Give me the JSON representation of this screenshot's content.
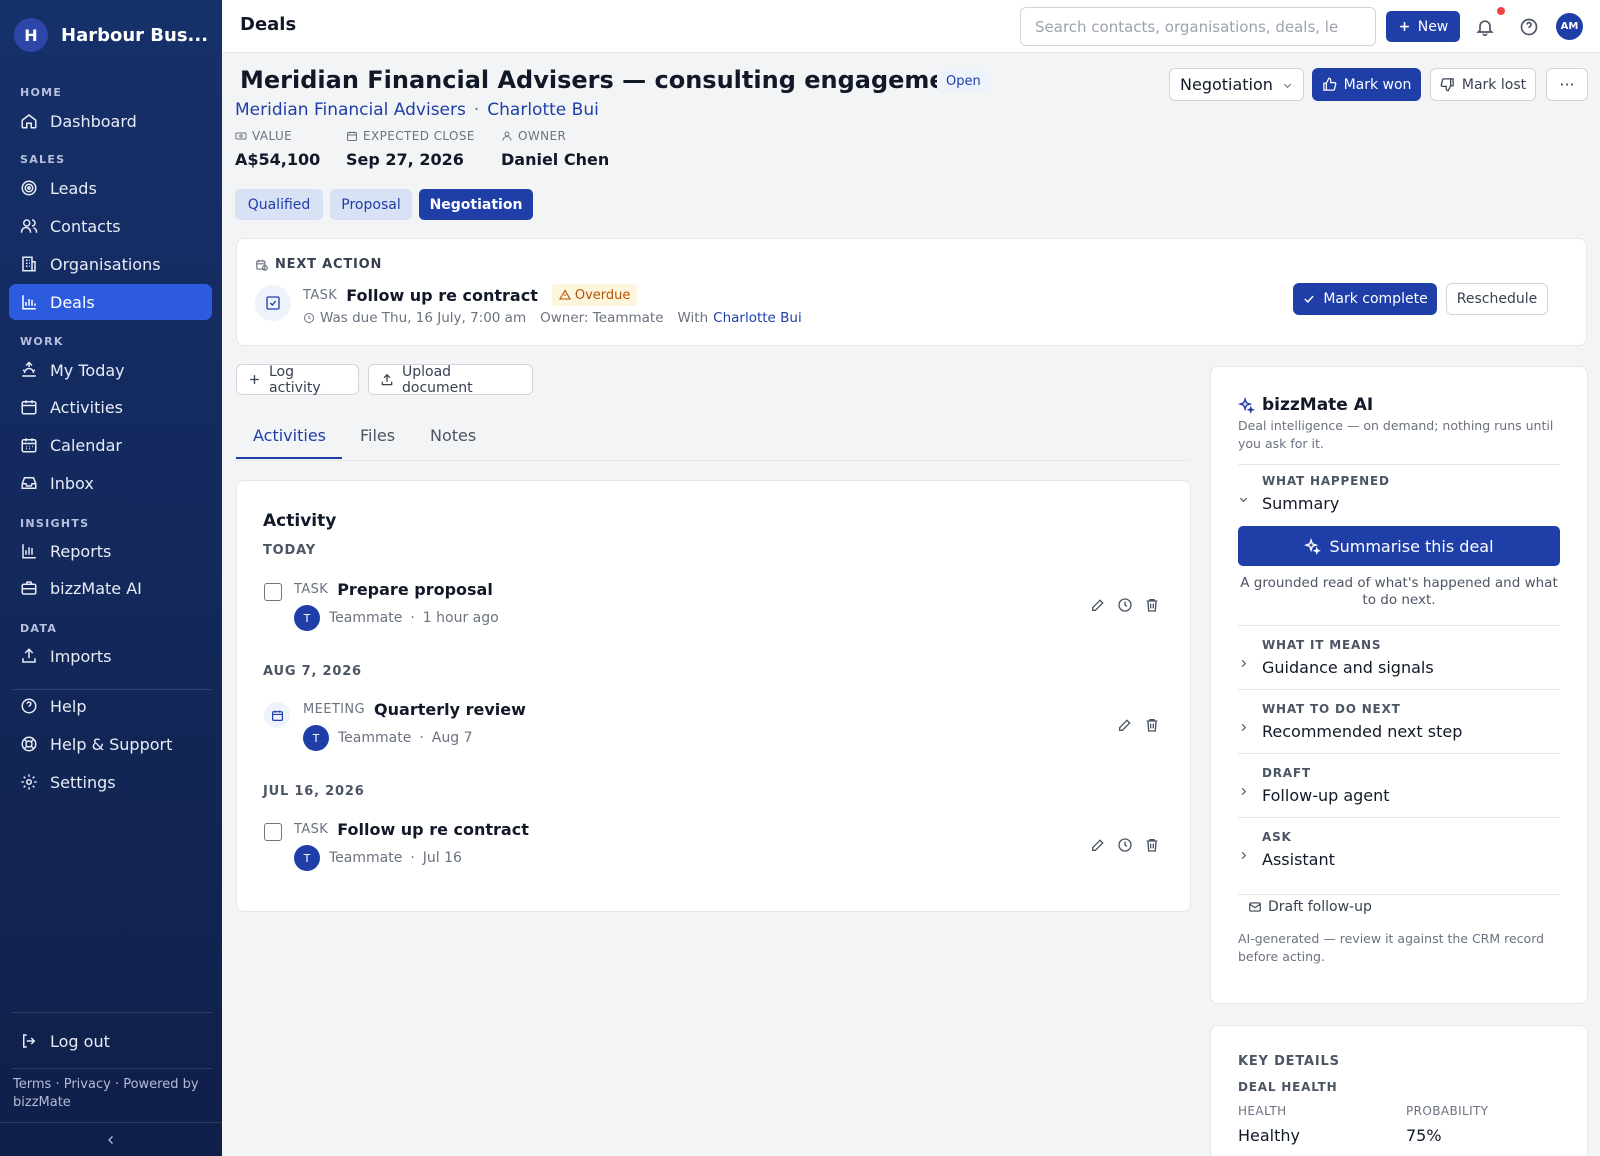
{
  "brand": {
    "initial": "H",
    "name": "Harbour Bus..."
  },
  "sidebar": {
    "sections": {
      "home": "HOME",
      "sales": "SALES",
      "work": "WORK",
      "insights": "INSIGHTS",
      "data": "DATA"
    },
    "items": {
      "dashboard": "Dashboard",
      "leads": "Leads",
      "contacts": "Contacts",
      "organisations": "Organisations",
      "deals": "Deals",
      "my_today": "My Today",
      "activities": "Activities",
      "calendar": "Calendar",
      "inbox": "Inbox",
      "reports": "Reports",
      "bizzmate_ai": "bizzMate AI",
      "imports": "Imports",
      "help": "Help",
      "help_support": "Help & Support",
      "settings": "Settings",
      "logout": "Log out"
    },
    "active": "Deals",
    "footer": {
      "terms": "Terms",
      "privacy": "Privacy",
      "powered": "Powered by bizzMate",
      "dot": "·"
    }
  },
  "header": {
    "title": "Deals",
    "search_placeholder": "Search contacts, organisations, deals, le",
    "new_label": "New",
    "user_initials": "AM"
  },
  "deal": {
    "title": "Meridian Financial Advisers — consulting engagement",
    "status": "Open",
    "organisation": "Meridian Financial Advisers",
    "separator": "·",
    "contact": "Charlotte Bui",
    "value_label": "VALUE",
    "value": "A$54,100",
    "close_label": "EXPECTED CLOSE",
    "close": "Sep 27, 2026",
    "owner_label": "OWNER",
    "owner": "Daniel Chen",
    "stage_select": "Negotiation",
    "mark_won": "Mark won",
    "mark_lost": "Mark lost",
    "more": "···",
    "stages": [
      "Qualified",
      "Proposal",
      "Negotiation"
    ],
    "current_stage": "Negotiation"
  },
  "next_action": {
    "label": "NEXT ACTION",
    "kind": "TASK",
    "title": "Follow up re contract",
    "badge": "Overdue",
    "due": "Was due Thu, 16 July, 7:00 am",
    "owner": "Owner: Teammate",
    "with_label": "With",
    "with": "Charlotte Bui",
    "complete_label": "Mark complete",
    "reschedule_label": "Reschedule"
  },
  "actions": {
    "log_activity": "Log activity",
    "upload_document": "Upload document"
  },
  "tabs": [
    "Activities",
    "Files",
    "Notes"
  ],
  "active_tab": "Activities",
  "activity": {
    "heading": "Activity",
    "groups": [
      {
        "date": "TODAY",
        "items": [
          {
            "kind": "TASK",
            "title": "Prepare proposal",
            "avatar": "T",
            "person": "Teammate",
            "when": "1 hour ago"
          }
        ]
      },
      {
        "date": "AUG 7, 2026",
        "items": [
          {
            "kind": "MEETING",
            "title": "Quarterly review",
            "avatar": "T",
            "person": "Teammate",
            "when": "Aug 7"
          }
        ]
      },
      {
        "date": "JUL 16, 2026",
        "items": [
          {
            "kind": "TASK",
            "title": "Follow up re contract",
            "avatar": "T",
            "person": "Teammate",
            "when": "Jul 16"
          }
        ]
      }
    ],
    "dot": "·"
  },
  "ai": {
    "title": "bizzMate AI",
    "description": "Deal intelligence — on demand; nothing runs until you ask for it.",
    "sections": [
      {
        "key": "WHAT HAPPENED",
        "value": "Summary",
        "expanded": true
      },
      {
        "key": "WHAT IT MEANS",
        "value": "Guidance and signals",
        "expanded": false
      },
      {
        "key": "WHAT TO DO NEXT",
        "value": "Recommended next step",
        "expanded": false
      },
      {
        "key": "DRAFT",
        "value": "Follow-up agent",
        "expanded": false
      },
      {
        "key": "ASK",
        "value": "Assistant",
        "expanded": false
      }
    ],
    "summarise_label": "Summarise this deal",
    "summarise_help": "A grounded read of what's happened and what to do next.",
    "draft_followup": "Draft follow-up",
    "note": "AI-generated — review it against the CRM record before acting."
  },
  "key_details": {
    "heading": "KEY DETAILS",
    "subheading": "DEAL HEALTH",
    "health_label": "HEALTH",
    "health": "Healthy",
    "probability_label": "PROBABILITY",
    "probability": "75%"
  },
  "colors": {
    "primary": "#1f3ea8",
    "sidebar": "#16306a",
    "active_nav": "#2d5be0",
    "overdue": "#b45309",
    "notification": "#ef4444"
  }
}
